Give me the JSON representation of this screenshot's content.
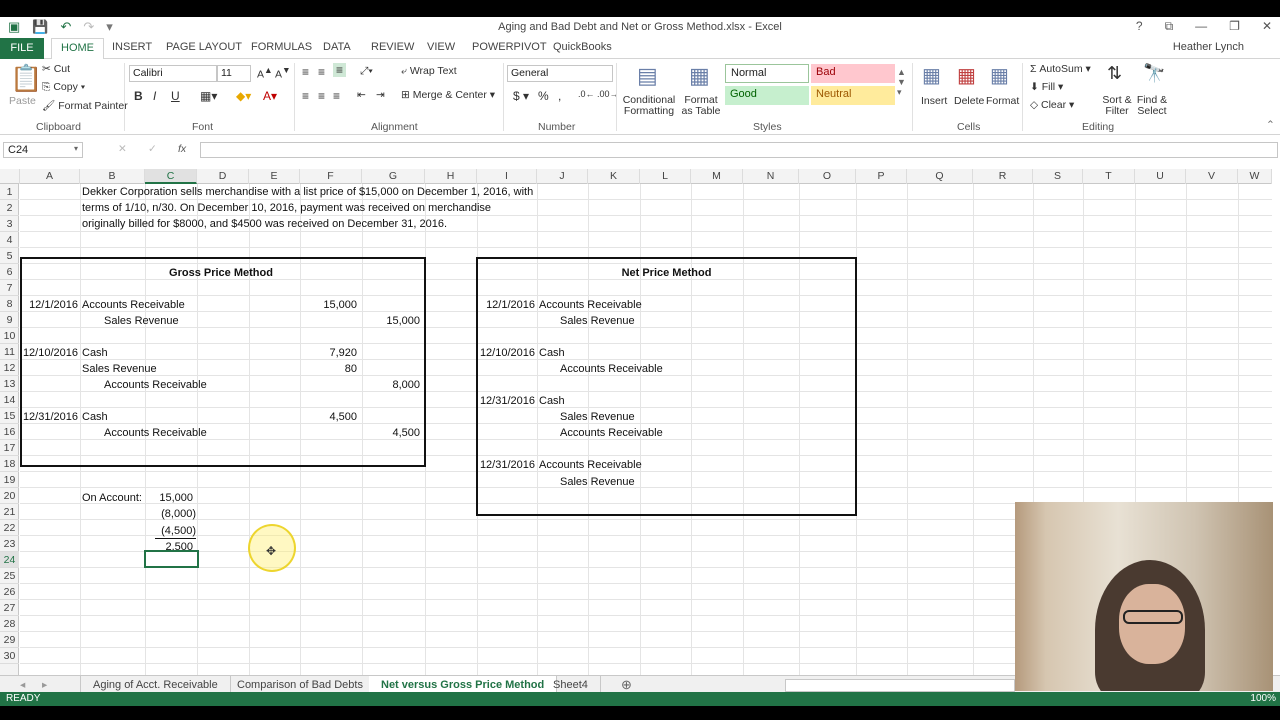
{
  "window": {
    "title": "Aging and Bad Debt and Net or Gross Method.xlsx - Excel",
    "help": "?",
    "user": "Heather Lynch"
  },
  "tabs": [
    "FILE",
    "HOME",
    "INSERT",
    "PAGE LAYOUT",
    "FORMULAS",
    "DATA",
    "REVIEW",
    "VIEW",
    "POWERPIVOT",
    "QuickBooks"
  ],
  "ribbon": {
    "clipboard": {
      "paste": "Paste",
      "cut": "Cut",
      "copy": "Copy",
      "format_painter": "Format Painter",
      "label": "Clipboard"
    },
    "font": {
      "name": "Calibri",
      "size": "11",
      "label": "Font"
    },
    "alignment": {
      "wrap": "Wrap Text",
      "merge": "Merge & Center",
      "label": "Alignment"
    },
    "number": {
      "format": "General",
      "label": "Number"
    },
    "styles": {
      "cond": "Conditional Formatting",
      "table": "Format as Table",
      "normal": "Normal",
      "bad": "Bad",
      "good": "Good",
      "neutral": "Neutral",
      "label": "Styles"
    },
    "cells": {
      "insert": "Insert",
      "delete": "Delete",
      "format": "Format",
      "label": "Cells"
    },
    "editing": {
      "autosum": "AutoSum",
      "fill": "Fill",
      "clear": "Clear",
      "sort": "Sort & Filter",
      "find": "Find & Select",
      "label": "Editing"
    }
  },
  "formula_bar": {
    "namebox": "C24",
    "fx": "fx",
    "content": ""
  },
  "columns": [
    "A",
    "B",
    "C",
    "D",
    "E",
    "F",
    "G",
    "H",
    "I",
    "J",
    "K",
    "L",
    "M",
    "N",
    "O",
    "P",
    "Q",
    "R",
    "S",
    "T",
    "U",
    "V",
    "W"
  ],
  "rows": [
    "1",
    "2",
    "3",
    "4",
    "5",
    "6",
    "7",
    "8",
    "9",
    "10",
    "11",
    "12",
    "13",
    "14",
    "15",
    "16",
    "17",
    "18",
    "19",
    "20",
    "21",
    "22",
    "23",
    "24",
    "25",
    "26",
    "27",
    "28",
    "29",
    "30"
  ],
  "sheet": {
    "intro": [
      "Dekker Corporation sells merchandise with a list price of $15,000 on December 1, 2016, with",
      "terms of 1/10, n/30.  On December 10, 2016, payment was received on merchandise",
      "originally billed for $8000, and $4500 was received on December 31, 2016."
    ],
    "gross": {
      "title": "Gross  Price Method",
      "d1": "12/1/2016",
      "ar1": "Accounts Receivable",
      "v1": "15,000",
      "sr1": "Sales Revenue",
      "v2": "15,000",
      "d2": "12/10/2016",
      "cash2": "Cash",
      "v3": "7,920",
      "sr2": "Sales Revenue",
      "v4": "80",
      "ar2": "Accounts Receivable",
      "v5": "8,000",
      "d3": "12/31/2016",
      "cash3": "Cash",
      "v6": "4,500",
      "ar3": "Accounts Receivable",
      "v7": "4,500"
    },
    "net": {
      "title": "Net Price Method",
      "d1": "12/1/2016",
      "ar1": "Accounts Receivable",
      "sr1": "Sales Revenue",
      "d2": "12/10/2016",
      "cash2": "Cash",
      "ar2": "Accounts Receivable",
      "d3": "12/31/2016",
      "cash3": "Cash",
      "sr3": "Sales Revenue",
      "ar3": "Accounts Receivable",
      "d4": "12/31/2016",
      "ar4": "Accounts Receivable",
      "sr4": "Sales Revenue"
    },
    "onaccount": {
      "label": "On Account:",
      "a": "15,000",
      "b": "(8,000)",
      "c": "(4,500)",
      "d": "2,500"
    }
  },
  "sheet_tabs": [
    "Aging of Acct. Receivable",
    "Comparison of Bad Debts",
    "Net versus Gross Price Method",
    "Sheet4"
  ],
  "status": {
    "ready": "READY",
    "zoom": "100%"
  }
}
